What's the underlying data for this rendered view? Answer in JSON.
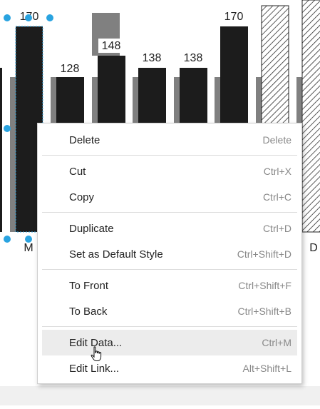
{
  "chart_data": {
    "type": "bar",
    "title": "",
    "xlabel": "",
    "ylabel": "",
    "categories": [
      "",
      "M",
      "",
      "",
      "",
      "",
      "",
      "D"
    ],
    "visible_category_labels": [
      "M",
      "D"
    ],
    "series": [
      {
        "values": [
          null,
          170,
          128,
          148,
          138,
          138,
          170,
          null
        ]
      }
    ],
    "data_labels": [
      "170",
      "128",
      "148",
      "138",
      "138",
      "170"
    ],
    "selected_bar": "M",
    "colors": {
      "bar": "#1c1c1c",
      "shadow_bar": "#808080",
      "selection_handle": "#29a3e0"
    }
  },
  "context_menu": {
    "items": [
      {
        "label": "Delete",
        "shortcut": "Delete"
      },
      {
        "label": "Cut",
        "shortcut": "Ctrl+X"
      },
      {
        "label": "Copy",
        "shortcut": "Ctrl+C"
      },
      {
        "label": "Duplicate",
        "shortcut": "Ctrl+D"
      },
      {
        "label": "Set as Default Style",
        "shortcut": "Ctrl+Shift+D"
      },
      {
        "label": "To Front",
        "shortcut": "Ctrl+Shift+F"
      },
      {
        "label": "To Back",
        "shortcut": "Ctrl+Shift+B"
      },
      {
        "label": "Edit Data...",
        "shortcut": "Ctrl+M"
      },
      {
        "label": "Edit Link...",
        "shortcut": "Alt+Shift+L"
      }
    ],
    "hovered_item": "Edit Data..."
  },
  "cursor": {
    "type": "hand-pointer-icon"
  }
}
